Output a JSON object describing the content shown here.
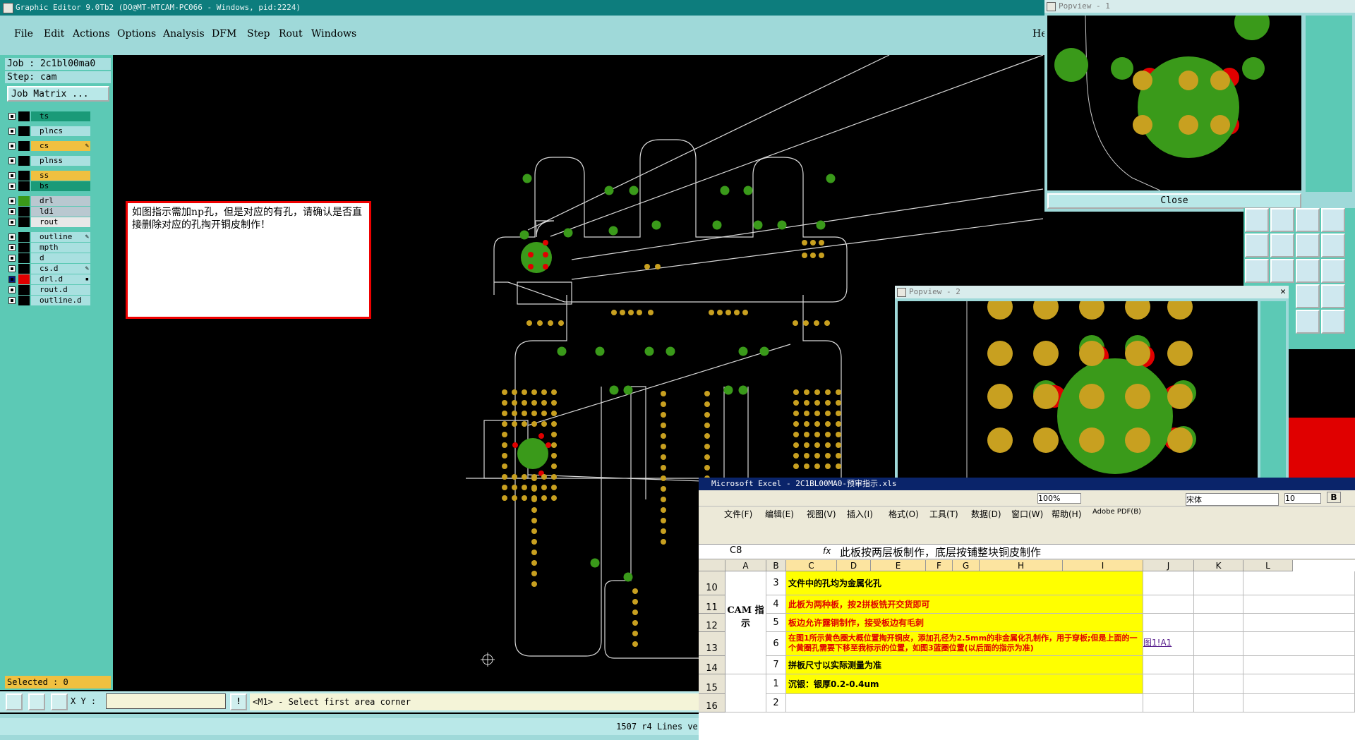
{
  "ge": {
    "title": "Graphic Editor 9.0Tb2  (DO@MT-MTCAM-PC066 - Windows, pid:2224)",
    "menu": [
      "File",
      "Edit",
      "Actions",
      "Options",
      "Analysis",
      "DFM",
      "Step",
      "Rout",
      "Windows"
    ],
    "menu_help": "He",
    "job": "Job : 2c1bl00ma0",
    "step": "Step: cam",
    "job_matrix": "Job Matrix ...",
    "layers": [
      {
        "name": "ts",
        "color": "#1a9a78",
        "mark": ""
      },
      {
        "name": "plncs",
        "color": "#a9e0e0",
        "mark": ""
      },
      {
        "name": "cs",
        "color": "#f0c040",
        "mark": "✎"
      },
      {
        "name": "plnss",
        "color": "#a9e0e0",
        "mark": ""
      },
      {
        "name": "ss",
        "color": "#f0c040",
        "mark": ""
      },
      {
        "name": "bs",
        "color": "#1a9a78",
        "mark": ""
      },
      {
        "name": "drl",
        "color": "#b9c8d0",
        "mark": ""
      },
      {
        "name": "ldi",
        "color": "#b9c8d0",
        "mark": ""
      },
      {
        "name": "rout",
        "color": "#e8e8e8",
        "mark": ""
      },
      {
        "name": "outline",
        "color": "#a9e0e0",
        "mark": "✎"
      },
      {
        "name": "mpth",
        "color": "#a9e0e0",
        "mark": ""
      },
      {
        "name": "d",
        "color": "#a9e0e0",
        "mark": ""
      },
      {
        "name": "cs.d",
        "color": "#a9e0e0",
        "mark": "✎"
      },
      {
        "name": "drl.d",
        "color": "#a9e0e0",
        "mark": "▪"
      },
      {
        "name": "rout.d",
        "color": "#a9e0e0",
        "mark": ""
      },
      {
        "name": "outline.d",
        "color": "#a9e0e0",
        "mark": ""
      }
    ],
    "selected": "Selected : 0",
    "xy_label": "X Y :",
    "prompt": "<M1> - Select first area corner",
    "lines_info": "1507 r4 Lines ver",
    "note": "如图指示需加np孔，但是对应的有孔，请确认是否直接删除对应的孔掏开铜皮制作！"
  },
  "popview1": {
    "title": "Popview - 1",
    "close": "Close"
  },
  "popview2": {
    "title": "Popview - 2"
  },
  "excel": {
    "title": "Microsoft Excel - 2C1BL00MA0-预审指示.xls",
    "zoom": "100%",
    "font": "宋体",
    "size": "10",
    "menu": [
      "文件(F)",
      "编辑(E)",
      "视图(V)",
      "插入(I)",
      "格式(O)",
      "工具(T)",
      "数据(D)",
      "窗口(W)",
      "帮助(H)",
      "Adobe PDF(B)"
    ],
    "namebox": "C8",
    "fx": "fx",
    "formula": "此板按两层板制作，底层按铺整块铜皮制作",
    "columns": [
      "A",
      "B",
      "C",
      "D",
      "E",
      "F",
      "G",
      "H",
      "I",
      "J",
      "K",
      "L"
    ],
    "cam_label": "CAM 指示",
    "rows": [
      {
        "row": "10",
        "num": "3",
        "text": "文件中的孔均为金属化孔",
        "link": ""
      },
      {
        "row": "11",
        "num": "4",
        "text": "此板为两种板，按2拼板铣开交货即可",
        "link": ""
      },
      {
        "row": "12",
        "num": "5",
        "text": "板边允许露铜制作，接受板边有毛刺",
        "link": ""
      },
      {
        "row": "13",
        "num": "6",
        "text": "在图1所示黄色圈大概位置掏开铜皮，添加孔径为2.5mm的非金属化孔制作，用于穿板;但是上面的一个黄圈孔需要下移至我标示的位置，如图3蓝圈位置(以后面的指示为准)",
        "link": "图1!A1"
      },
      {
        "row": "14",
        "num": "7",
        "text": "拼板尺寸以实际测量为准",
        "link": ""
      },
      {
        "row": "15",
        "num": "1",
        "text": "沉银：银厚0.2-0.4um",
        "link": ""
      },
      {
        "row": "16",
        "num": "2",
        "text": "",
        "link": ""
      }
    ]
  },
  "colors": {
    "green_pad": "#3a9a1a",
    "yellow_pad": "#c8a020",
    "red": "#e00000",
    "outline": "#d8d8d8",
    "panel": "#5cc9b5"
  }
}
